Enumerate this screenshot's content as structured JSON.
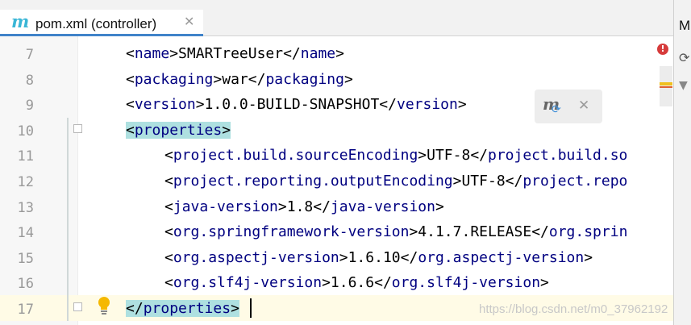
{
  "tab": {
    "icon": "m",
    "title": "pom.xml (controller)",
    "close": "✕"
  },
  "right_panel": {
    "letter": "M",
    "icons": [
      "refresh-icon",
      "triangle-down-icon"
    ]
  },
  "popup": {
    "icon": "maven-reload-icon",
    "close": "✕"
  },
  "watermark": "https://blog.csdn.net/m0_37962192",
  "colors": {
    "tag": "#000080",
    "tag_highlight": "#aee0e0",
    "current_line": "#fffbe6",
    "tab_underline": "#4083c9",
    "error": "#d63b3b"
  },
  "editor": {
    "lines": [
      {
        "num": "7",
        "open": "<",
        "name": "name",
        "close": ">",
        "value": "SMARTreeUser",
        "end_open": "</",
        "end_name": "name",
        "end_close": ">"
      },
      {
        "num": "8",
        "open": "<",
        "name": "packaging",
        "close": ">",
        "value": "war",
        "end_open": "</",
        "end_name": "packaging",
        "end_close": ">"
      },
      {
        "num": "9",
        "open": "<",
        "name": "version",
        "close": ">",
        "value": "1.0.0-BUILD-SNAPSHOT",
        "end_open": "</",
        "end_name": "version",
        "end_close": ">"
      },
      {
        "num": "10",
        "open": "<",
        "name": "properties",
        "close": ">"
      },
      {
        "num": "11",
        "open": "<",
        "name": "project.build.sourceEncoding",
        "close": ">",
        "value": "UTF-8",
        "end_open": "</",
        "end_name": "project.build.so"
      },
      {
        "num": "12",
        "open": "<",
        "name": "project.reporting.outputEncoding",
        "close": ">",
        "value": "UTF-8",
        "end_open": "</",
        "end_name": "project.repo"
      },
      {
        "num": "13",
        "open": "<",
        "name": "java-version",
        "close": ">",
        "value": "1.8",
        "end_open": "</",
        "end_name": "java-version",
        "end_close": ">"
      },
      {
        "num": "14",
        "open": "<",
        "name": "org.springframework-version",
        "close": ">",
        "value": "4.1.7.RELEASE",
        "end_open": "</",
        "end_name": "org.sprin"
      },
      {
        "num": "15",
        "open": "<",
        "name": "org.aspectj-version",
        "close": ">",
        "value": "1.6.10",
        "end_open": "</",
        "end_name": "org.aspectj-version",
        "end_close": ">"
      },
      {
        "num": "16",
        "open": "<",
        "name": "org.slf4j-version",
        "close": ">",
        "value": "1.6.6",
        "end_open": "</",
        "end_name": "org.slf4j-version",
        "end_close": ">"
      },
      {
        "num": "17",
        "open": "</",
        "name": "properties",
        "close": ">"
      }
    ]
  }
}
